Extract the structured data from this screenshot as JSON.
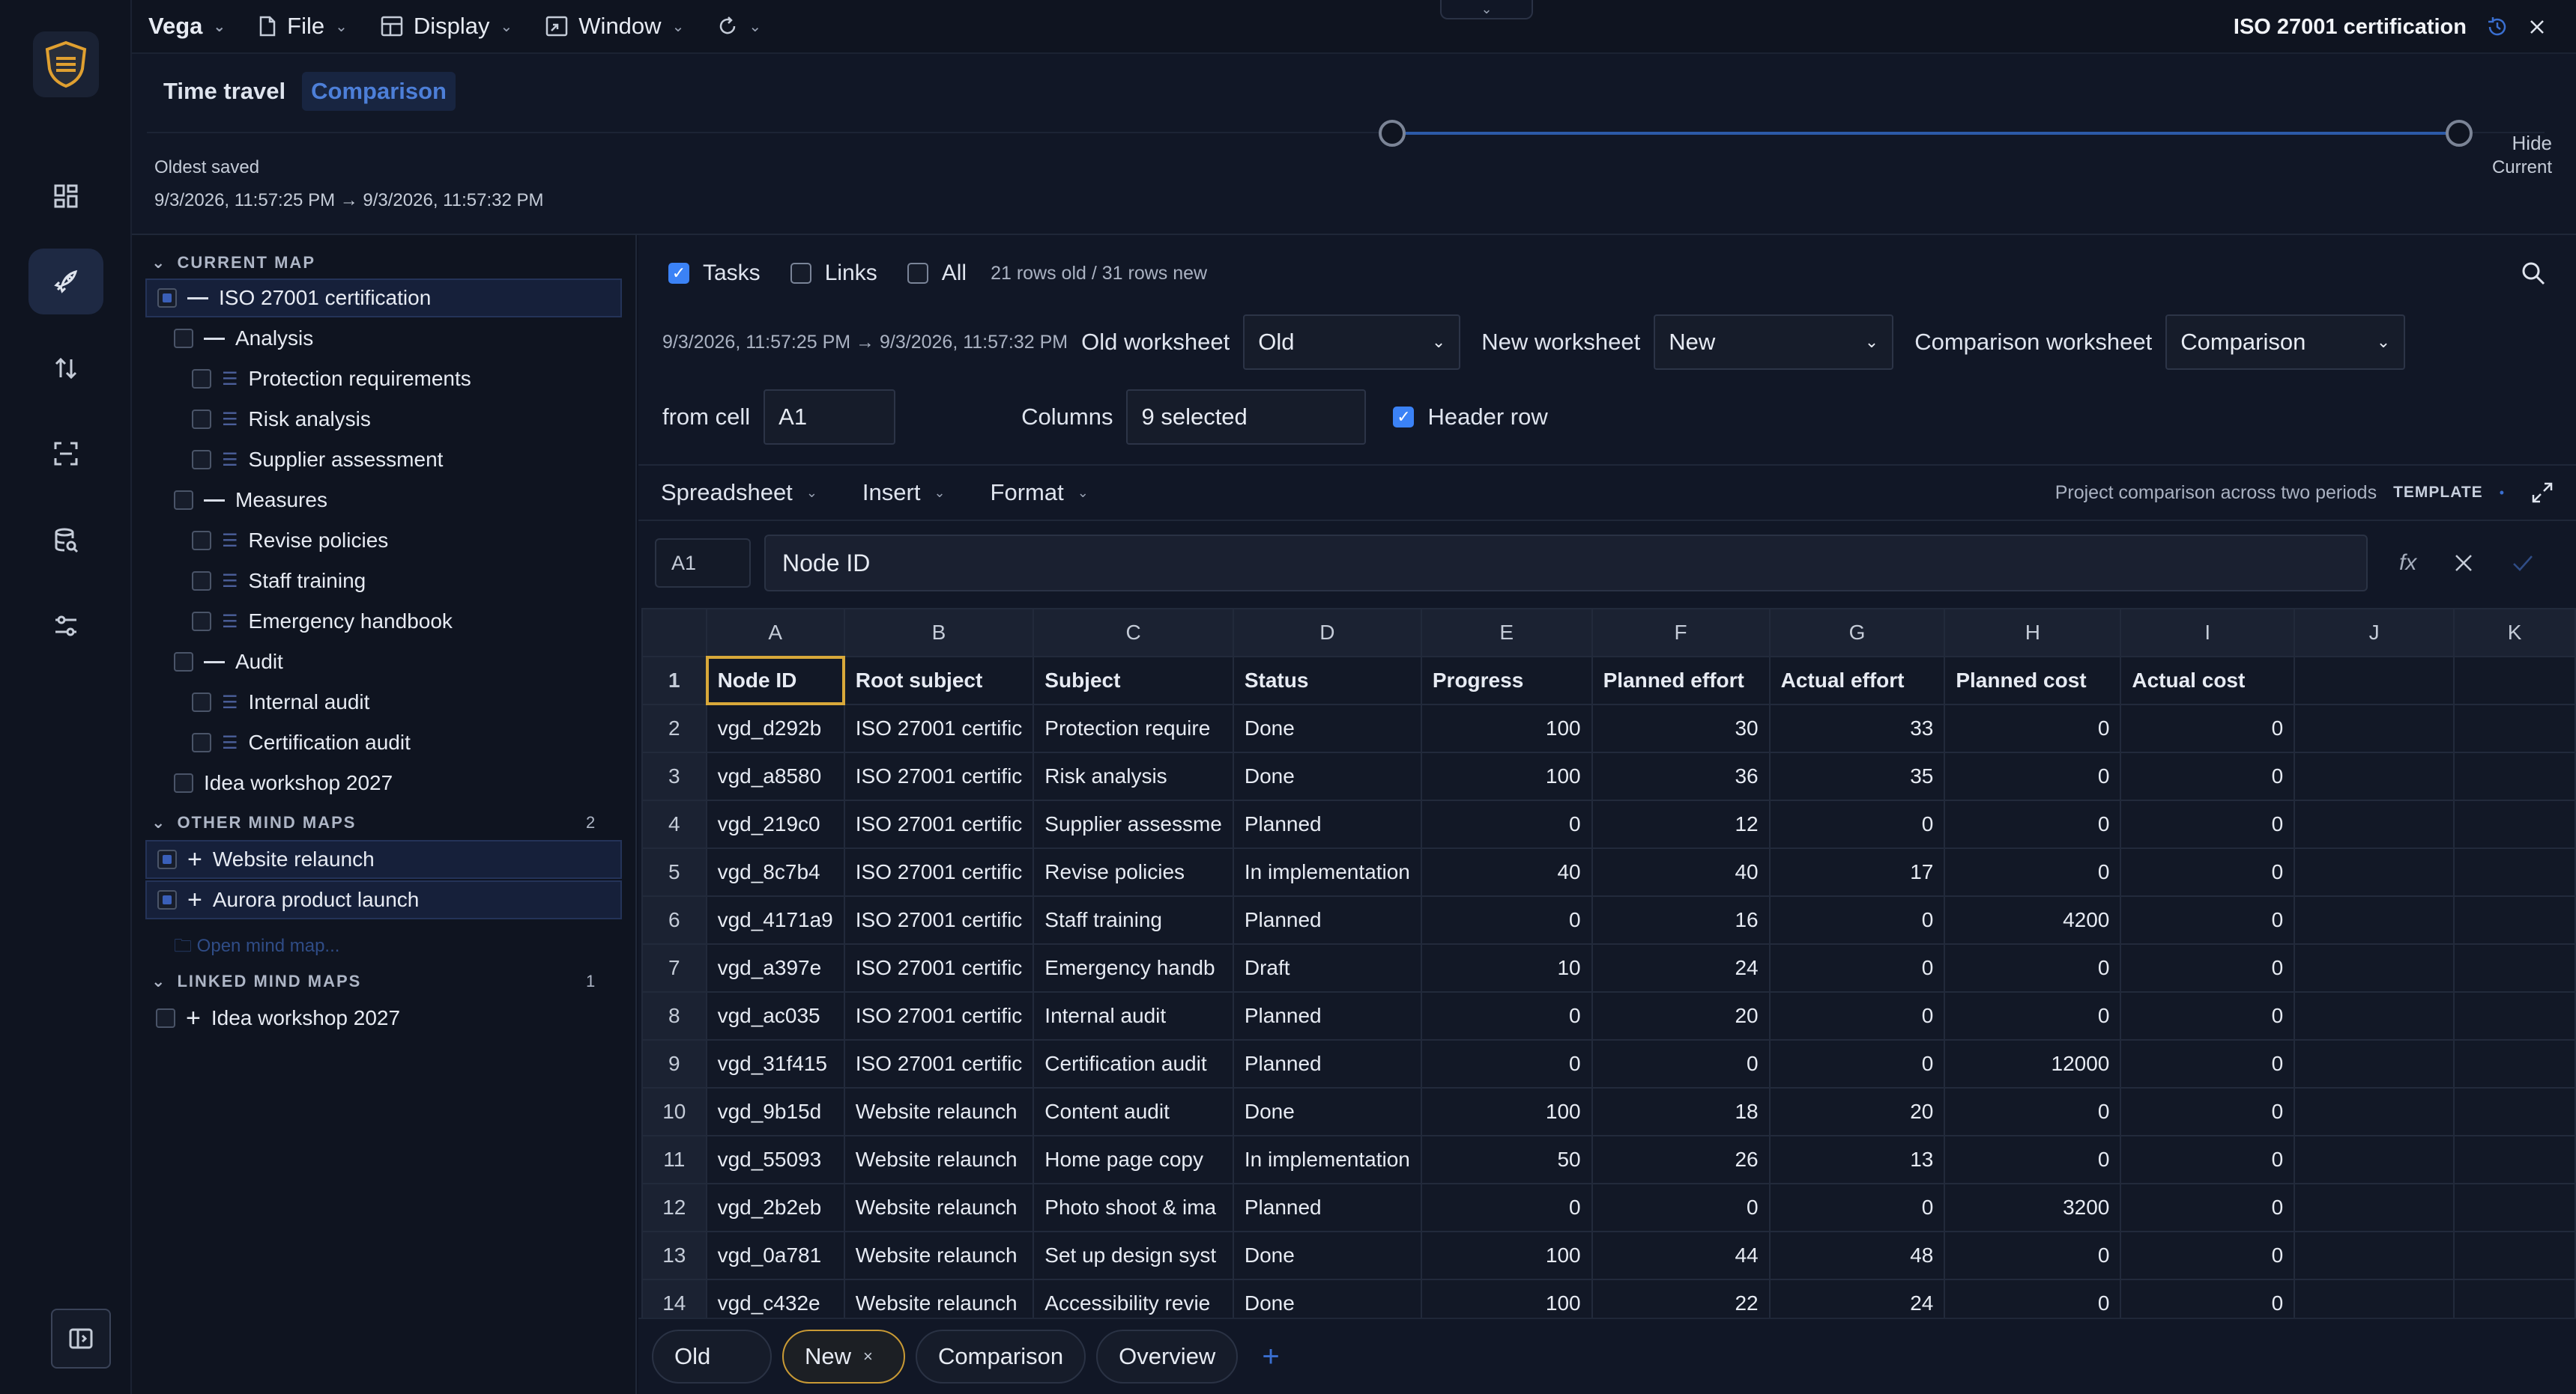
{
  "topbar": {
    "brand": "Vega",
    "menus": [
      "File",
      "Display",
      "Window"
    ],
    "doc_title": "ISO 27001 certification"
  },
  "time_travel": {
    "tab_time_travel": "Time travel",
    "tab_comparison": "Comparison",
    "hide": "Hide",
    "oldest_label": "Oldest saved",
    "range": "9/3/2026, 11:57:25 PM → 9/3/2026, 11:57:32 PM",
    "current_label": "Current",
    "slider_start": 0.0,
    "slider_end": 1.0
  },
  "sidebar": {
    "current_map_title": "CURRENT MAP",
    "other_maps_title": "OTHER MIND MAPS",
    "other_maps_count": "2",
    "linked_maps_title": "LINKED MIND MAPS",
    "linked_maps_count": "1",
    "open_mind_map": "Open mind map...",
    "tree": [
      {
        "label": "ISO 27001 certification",
        "level": 0,
        "kind": "dash"
      },
      {
        "label": "Analysis",
        "level": 1,
        "kind": "dash"
      },
      {
        "label": "Protection requirements",
        "level": 2,
        "kind": "list"
      },
      {
        "label": "Risk analysis",
        "level": 2,
        "kind": "list"
      },
      {
        "label": "Supplier assessment",
        "level": 2,
        "kind": "list"
      },
      {
        "label": "Measures",
        "level": 1,
        "kind": "dash"
      },
      {
        "label": "Revise policies",
        "level": 2,
        "kind": "list"
      },
      {
        "label": "Staff training",
        "level": 2,
        "kind": "list"
      },
      {
        "label": "Emergency handbook",
        "level": 2,
        "kind": "list"
      },
      {
        "label": "Audit",
        "level": 1,
        "kind": "dash"
      },
      {
        "label": "Internal audit",
        "level": 2,
        "kind": "list"
      },
      {
        "label": "Certification audit",
        "level": 2,
        "kind": "list"
      },
      {
        "label": "Idea workshop 2027",
        "level": 1,
        "kind": "none"
      }
    ],
    "other_maps": [
      "Website relaunch",
      "Aurora product launch"
    ],
    "linked_maps": [
      "Idea workshop 2027"
    ]
  },
  "options": {
    "tasks": "Tasks",
    "links": "Links",
    "all": "All",
    "rows_info": "21 rows old / 31 rows new",
    "range": "9/3/2026, 11:57:25 PM → 9/3/2026, 11:57:32 PM",
    "old_worksheet_label": "Old worksheet",
    "old_worksheet_value": "Old",
    "new_worksheet_label": "New worksheet",
    "new_worksheet_value": "New",
    "comparison_worksheet_label": "Comparison worksheet",
    "comparison_worksheet_value": "Comparison",
    "from_cell_label": "from cell",
    "from_cell_value": "A1",
    "columns_label": "Columns",
    "columns_value": "9 selected",
    "header_row": "Header row"
  },
  "toolbar": {
    "menus": [
      "Spreadsheet",
      "Insert",
      "Format"
    ],
    "description": "Project comparison across two periods",
    "template": "TEMPLATE"
  },
  "formula": {
    "cell": "A1",
    "value": "Node ID",
    "fx": "fx"
  },
  "grid": {
    "columns": [
      "A",
      "B",
      "C",
      "D",
      "E",
      "F",
      "G",
      "H",
      "I",
      "J",
      "K"
    ],
    "rows": [
      [
        "Node ID",
        "Root subject",
        "Subject",
        "Status",
        "Progress",
        "Planned effort",
        "Actual effort",
        "Planned cost",
        "Actual cost",
        "",
        ""
      ],
      [
        "vgd_d292b",
        "ISO 27001 certific",
        "Protection require",
        "Done",
        "100",
        "30",
        "33",
        "0",
        "0",
        "",
        ""
      ],
      [
        "vgd_a8580",
        "ISO 27001 certific",
        "Risk analysis",
        "Done",
        "100",
        "36",
        "35",
        "0",
        "0",
        "",
        ""
      ],
      [
        "vgd_219c0",
        "ISO 27001 certific",
        "Supplier assessme",
        "Planned",
        "0",
        "12",
        "0",
        "0",
        "0",
        "",
        ""
      ],
      [
        "vgd_8c7b4",
        "ISO 27001 certific",
        "Revise policies",
        "In implementation",
        "40",
        "40",
        "17",
        "0",
        "0",
        "",
        ""
      ],
      [
        "vgd_4171a9",
        "ISO 27001 certific",
        "Staff training",
        "Planned",
        "0",
        "16",
        "0",
        "4200",
        "0",
        "",
        ""
      ],
      [
        "vgd_a397e",
        "ISO 27001 certific",
        "Emergency handb",
        "Draft",
        "10",
        "24",
        "0",
        "0",
        "0",
        "",
        ""
      ],
      [
        "vgd_ac035",
        "ISO 27001 certific",
        "Internal audit",
        "Planned",
        "0",
        "20",
        "0",
        "0",
        "0",
        "",
        ""
      ],
      [
        "vgd_31f415",
        "ISO 27001 certific",
        "Certification audit",
        "Planned",
        "0",
        "0",
        "0",
        "12000",
        "0",
        "",
        ""
      ],
      [
        "vgd_9b15d",
        "Website relaunch",
        "Content audit",
        "Done",
        "100",
        "18",
        "20",
        "0",
        "0",
        "",
        ""
      ],
      [
        "vgd_55093",
        "Website relaunch",
        "Home page copy",
        "In implementation",
        "50",
        "26",
        "13",
        "0",
        "0",
        "",
        ""
      ],
      [
        "vgd_2b2eb",
        "Website relaunch",
        "Photo shoot & ima",
        "Planned",
        "0",
        "0",
        "0",
        "3200",
        "0",
        "",
        ""
      ],
      [
        "vgd_0a781",
        "Website relaunch",
        "Set up design syst",
        "Done",
        "100",
        "44",
        "48",
        "0",
        "0",
        "",
        ""
      ],
      [
        "vgd_c432e",
        "Website relaunch",
        "Accessibility revie",
        "Done",
        "100",
        "22",
        "24",
        "0",
        "0",
        "",
        ""
      ]
    ]
  },
  "sheets": {
    "tabs": [
      "Old",
      "New",
      "Comparison",
      "Overview"
    ],
    "current": "New",
    "close": "×",
    "add": "+"
  }
}
